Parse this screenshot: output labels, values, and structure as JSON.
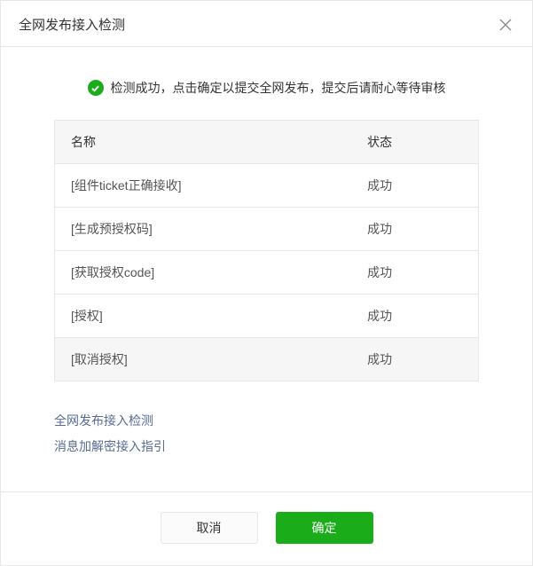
{
  "header": {
    "title": "全网发布接入检测"
  },
  "message": {
    "text": "检测成功，点击确定以提交全网发布，提交后请耐心等待审核"
  },
  "table": {
    "col_name": "名称",
    "col_status": "状态",
    "rows": [
      {
        "name": "[组件ticket正确接收]",
        "status": "成功"
      },
      {
        "name": "[生成预授权码]",
        "status": "成功"
      },
      {
        "name": "[获取授权code]",
        "status": "成功"
      },
      {
        "name": "[授权]",
        "status": "成功"
      },
      {
        "name": "[取消授权]",
        "status": "成功"
      }
    ]
  },
  "links": {
    "detect": "全网发布接入检测",
    "guide": "消息加解密接入指引"
  },
  "footer": {
    "cancel": "取消",
    "confirm": "确定"
  }
}
